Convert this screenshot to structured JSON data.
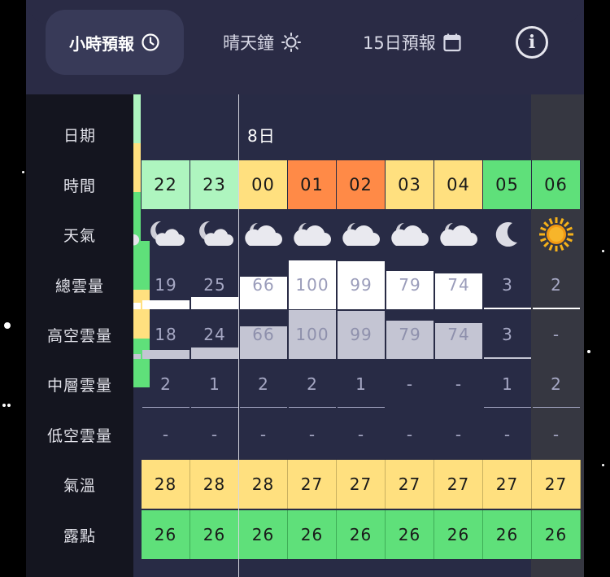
{
  "tabs": [
    {
      "label": "小時預報",
      "icon": "clock-icon",
      "active": true
    },
    {
      "label": "晴天鐘",
      "icon": "sun-icon",
      "active": false
    },
    {
      "label": "15日預報",
      "icon": "calendar-icon",
      "active": false
    }
  ],
  "info_icon": "info-icon",
  "row_labels": {
    "date": "日期",
    "time": "時間",
    "weather": "天氣",
    "total_cloud": "總雲量",
    "high_cloud": "高空雲量",
    "mid_cloud": "中層雲量",
    "low_cloud": "低空雲量",
    "temperature": "氣溫",
    "dew_point": "露點"
  },
  "date_label": "8日",
  "hours": [
    "22",
    "23",
    "00",
    "01",
    "02",
    "03",
    "04",
    "05",
    "06"
  ],
  "hour_colors": [
    "#aef5bf",
    "#aef5bf",
    "#ffe07f",
    "#ff8a47",
    "#ff8a47",
    "#ffe07f",
    "#ffe07f",
    "#5fe07a",
    "#5fe07a"
  ],
  "weather_icons": [
    "moon-cloud-icon",
    "moon-cloud-icon",
    "cloud-icon",
    "cloud-icon",
    "cloud-icon",
    "cloud-icon",
    "cloud-icon",
    "moon-icon",
    "sun-icon"
  ],
  "total_cloud": [
    "19",
    "25",
    "66",
    "100",
    "99",
    "79",
    "74",
    "3",
    "2"
  ],
  "high_cloud": [
    "18",
    "24",
    "66",
    "100",
    "99",
    "79",
    "74",
    "3",
    "-"
  ],
  "mid_cloud": [
    "2",
    "1",
    "2",
    "2",
    "1",
    "-",
    "-",
    "1",
    "2"
  ],
  "low_cloud": [
    "-",
    "-",
    "-",
    "-",
    "-",
    "-",
    "-",
    "-",
    "-"
  ],
  "temperature": [
    "28",
    "28",
    "28",
    "27",
    "27",
    "27",
    "27",
    "27",
    "27"
  ],
  "dew_point": [
    "26",
    "26",
    "26",
    "26",
    "26",
    "26",
    "26",
    "26",
    "26"
  ],
  "colors": {
    "temperature_bg": "#ffe07f",
    "dew_point_bg": "#5fe07a",
    "total_cloud_bar": "#ffffff",
    "high_cloud_bar": "#c4c5d3"
  }
}
